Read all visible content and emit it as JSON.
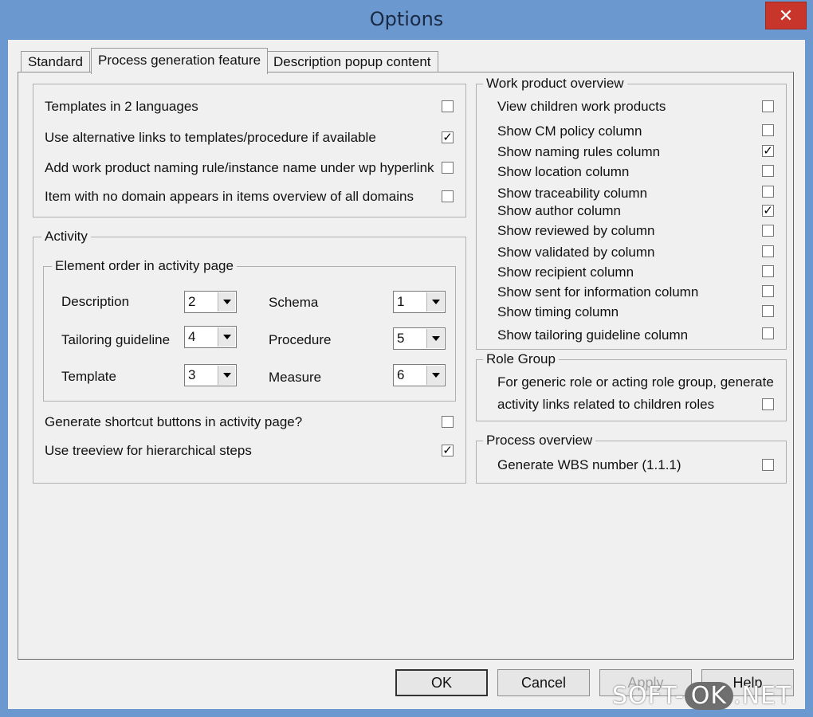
{
  "window": {
    "title": "Options",
    "close_glyph": "✕"
  },
  "tabs": [
    {
      "label": "Standard",
      "active": false
    },
    {
      "label": "Process generation feature",
      "active": true
    },
    {
      "label": "Description popup content",
      "active": false
    }
  ],
  "general": {
    "items": [
      {
        "label": "Templates in 2 languages",
        "checked": false
      },
      {
        "label": "Use alternative links to templates/procedure if available",
        "checked": true
      },
      {
        "label": "Add work product naming rule/instance name under wp hyperlink",
        "checked": false
      },
      {
        "label": "Item with no domain appears in items overview of all domains",
        "checked": false
      }
    ]
  },
  "activity": {
    "legend": "Activity",
    "element_order": {
      "legend": "Element order in activity page",
      "fields": [
        {
          "label": "Description",
          "value": "2"
        },
        {
          "label": "Schema",
          "value": "1"
        },
        {
          "label": "Tailoring guideline",
          "value": "4"
        },
        {
          "label": "Procedure",
          "value": "5"
        },
        {
          "label": "Template",
          "value": "3"
        },
        {
          "label": "Measure",
          "value": "6"
        }
      ]
    },
    "items": [
      {
        "label": "Generate shortcut buttons in activity page?",
        "checked": false
      },
      {
        "label": "Use treeview for hierarchical steps",
        "checked": true
      }
    ]
  },
  "work_product_overview": {
    "legend": "Work product overview",
    "items": [
      {
        "label": "View children work products",
        "checked": false
      },
      {
        "label": "Show CM policy column",
        "checked": false
      },
      {
        "label": "Show naming rules column",
        "checked": true
      },
      {
        "label": "Show location column",
        "checked": false
      },
      {
        "label": "Show traceability column",
        "checked": false
      },
      {
        "label": "Show author column",
        "checked": true
      },
      {
        "label": "Show reviewed by column",
        "checked": false
      },
      {
        "label": "Show validated by column",
        "checked": false
      },
      {
        "label": "Show recipient column",
        "checked": false
      },
      {
        "label": "Show sent for information column",
        "checked": false
      },
      {
        "label": "Show timing column",
        "checked": false
      },
      {
        "label": "Show tailoring guideline column",
        "checked": false
      }
    ]
  },
  "role_group": {
    "legend": "Role Group",
    "line1": "For generic role or acting role  group, generate",
    "line2": "activity links related to children roles",
    "checked": false
  },
  "process_overview": {
    "legend": "Process overview",
    "label": "Generate WBS number (1.1.1)",
    "checked": false
  },
  "buttons": {
    "ok": "OK",
    "cancel": "Cancel",
    "apply": "Apply",
    "help": "Help"
  },
  "watermark": {
    "left": "SOFT-",
    "ok": "OK",
    "right": ".NET"
  }
}
